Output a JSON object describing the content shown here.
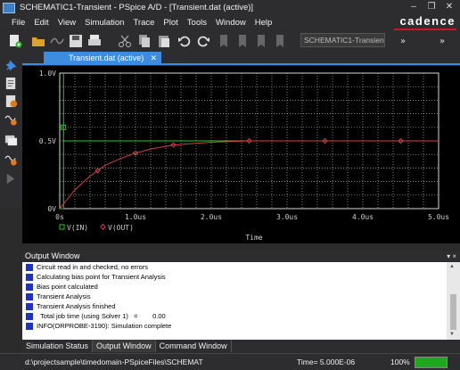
{
  "window": {
    "title": "SCHEMATIC1-Transient - PSpice A/D  - [Transient.dat (active)]",
    "minimize": "–",
    "restore": "❐",
    "close": "✕"
  },
  "menu": [
    "File",
    "Edit",
    "View",
    "Simulation",
    "Trace",
    "Plot",
    "Tools",
    "Window",
    "Help"
  ],
  "brand": "cadence",
  "toolbar": {
    "profile_select": "SCHEMATIC1-Transient"
  },
  "document_tab": {
    "label": "Transient.dat (active)",
    "close": "✕"
  },
  "plot": {
    "x_ticks": [
      "0s",
      "1.0us",
      "2.0us",
      "3.0us",
      "4.0us",
      "5.0us"
    ],
    "y_ticks": [
      "0V",
      "0.5V",
      "1.0V"
    ],
    "xlabel": "Time",
    "legend": [
      {
        "marker": "square",
        "label": "V(IN)",
        "color": "#22cc22"
      },
      {
        "marker": "diamond",
        "label": "V(OUT)",
        "color": "#d04040"
      }
    ]
  },
  "chart_data": {
    "type": "line",
    "xlabel": "Time",
    "ylabel": "",
    "xlim": [
      0,
      5.0
    ],
    "x_unit": "us",
    "ylim": [
      0,
      1.0
    ],
    "y_unit": "V",
    "grid": true,
    "legend_position": "bottom-left",
    "series": [
      {
        "name": "V(IN)",
        "color": "#22cc22",
        "x": [
          0,
          0.05,
          0.05,
          0.05,
          5.0
        ],
        "y": [
          0,
          0,
          1.0,
          0.5,
          0.5
        ]
      },
      {
        "name": "V(OUT)",
        "color": "#d04040",
        "x": [
          0,
          0.1,
          0.2,
          0.3,
          0.4,
          0.5,
          0.6,
          0.8,
          1.0,
          1.2,
          1.5,
          2.0,
          2.5,
          3.0,
          3.5,
          4.0,
          4.5,
          5.0
        ],
        "y": [
          0,
          0.07,
          0.14,
          0.19,
          0.24,
          0.28,
          0.32,
          0.37,
          0.41,
          0.44,
          0.47,
          0.49,
          0.5,
          0.5,
          0.5,
          0.5,
          0.5,
          0.5
        ]
      }
    ]
  },
  "output_window": {
    "title": "Output Window",
    "controls": "▾ ×",
    "lines": [
      "Circuit read in and checked, no errors",
      "Calculating bias point for Transient Analysis",
      "Bias point calculated",
      "Transient Analysis",
      "Transient Analysis finished",
      "  Total job time (using Solver 1)   =        0.00",
      "INFO(ORPROBE-3190): Simulation complete"
    ]
  },
  "bottom_tabs": [
    "Simulation Status",
    "Output Window",
    "Command Window"
  ],
  "status": {
    "path": "d:\\projectsample\\timedomain-PSpiceFiles\\SCHEMAT",
    "time": "Time= 5.000E-06",
    "percent": "100%",
    "progress": 1.0
  },
  "colors": {
    "accent": "#3d8ce0",
    "grid": "#b5b5b5",
    "vin": "#22cc22",
    "vout": "#d04040"
  }
}
